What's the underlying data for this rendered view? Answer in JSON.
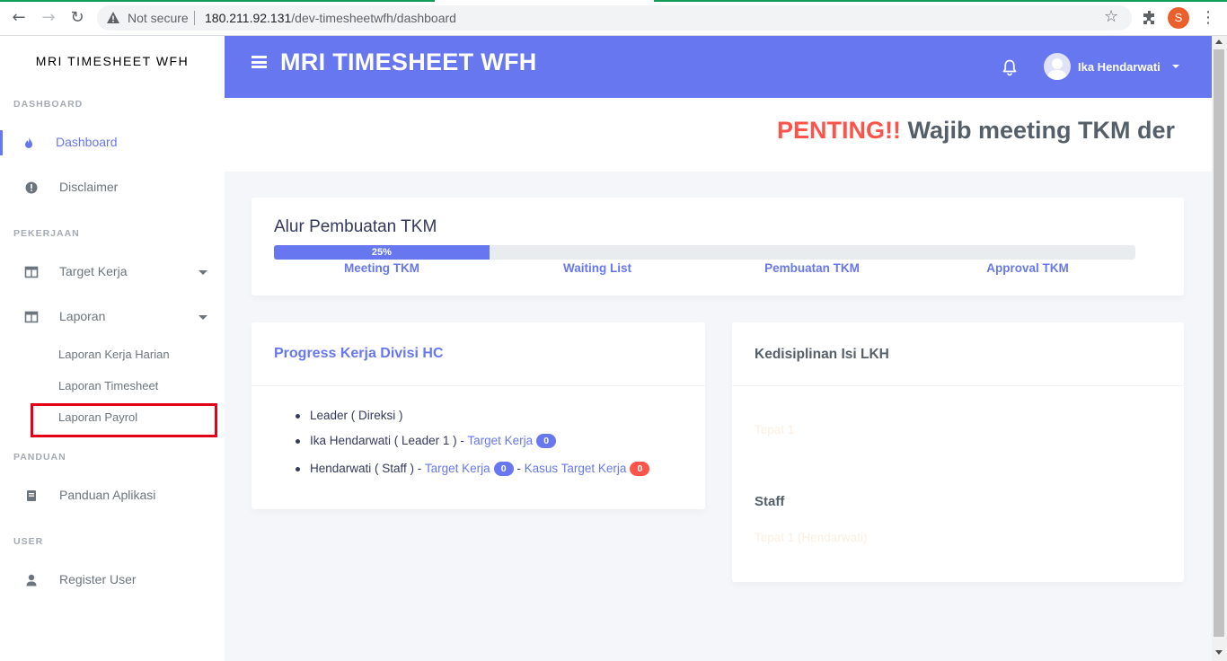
{
  "browser": {
    "security_label": "Not secure",
    "url_host": "180.211.92.131",
    "url_path": "/dev-timesheetwfh/dashboard",
    "profile_initial": "S"
  },
  "sidebar": {
    "brand": "MRI TIMESHEET WFH",
    "sections": {
      "dashboard": "DASHBOARD",
      "pekerjaan": "PEKERJAAN",
      "panduan": "PANDUAN",
      "user": "USER"
    },
    "items": {
      "dashboard": "Dashboard",
      "disclaimer": "Disclaimer",
      "target_kerja": "Target Kerja",
      "laporan": "Laporan",
      "panduan_aplikasi": "Panduan Aplikasi",
      "register_user": "Register User"
    },
    "laporan_sub": {
      "harian": "Laporan Kerja Harian",
      "timesheet": "Laporan Timesheet",
      "payrol": "Laporan Payrol"
    }
  },
  "topbar": {
    "title": "MRI TIMESHEET WFH",
    "user_name": "Ika Hendarwati"
  },
  "announcement": {
    "hot": "PENTING!!",
    "text": "Wajib meeting TKM der"
  },
  "alur": {
    "title": "Alur Pembuatan TKM",
    "progress_label": "25%",
    "progress_fraction": 0.25,
    "steps": [
      "Meeting TKM",
      "Waiting List",
      "Pembuatan TKM",
      "Approval TKM"
    ]
  },
  "progress_hc": {
    "title": "Progress Kerja Divisi HC",
    "row1": "Leader ( Direksi )",
    "row2_text": "Ika Hendarwati ( Leader 1 ) - ",
    "row2_link": "Target Kerja",
    "row2_badge": "0",
    "row3_text": "Hendarwati ( Staff ) - ",
    "row3_link1": "Target Kerja",
    "row3_badge1": "0",
    "row3_sep": " - ",
    "row3_link2": "Kasus Target Kerja",
    "row3_badge2": "0"
  },
  "kedisiplinan": {
    "title": "Kedisiplinan Isi LKH",
    "faint1": "Tepat 1",
    "staff_label": "Staff",
    "faint2": "Tepat 1 (Hendarwati)"
  },
  "colors": {
    "primary": "#6777ef",
    "danger": "#fc544b",
    "highlight": "#e3001b"
  }
}
